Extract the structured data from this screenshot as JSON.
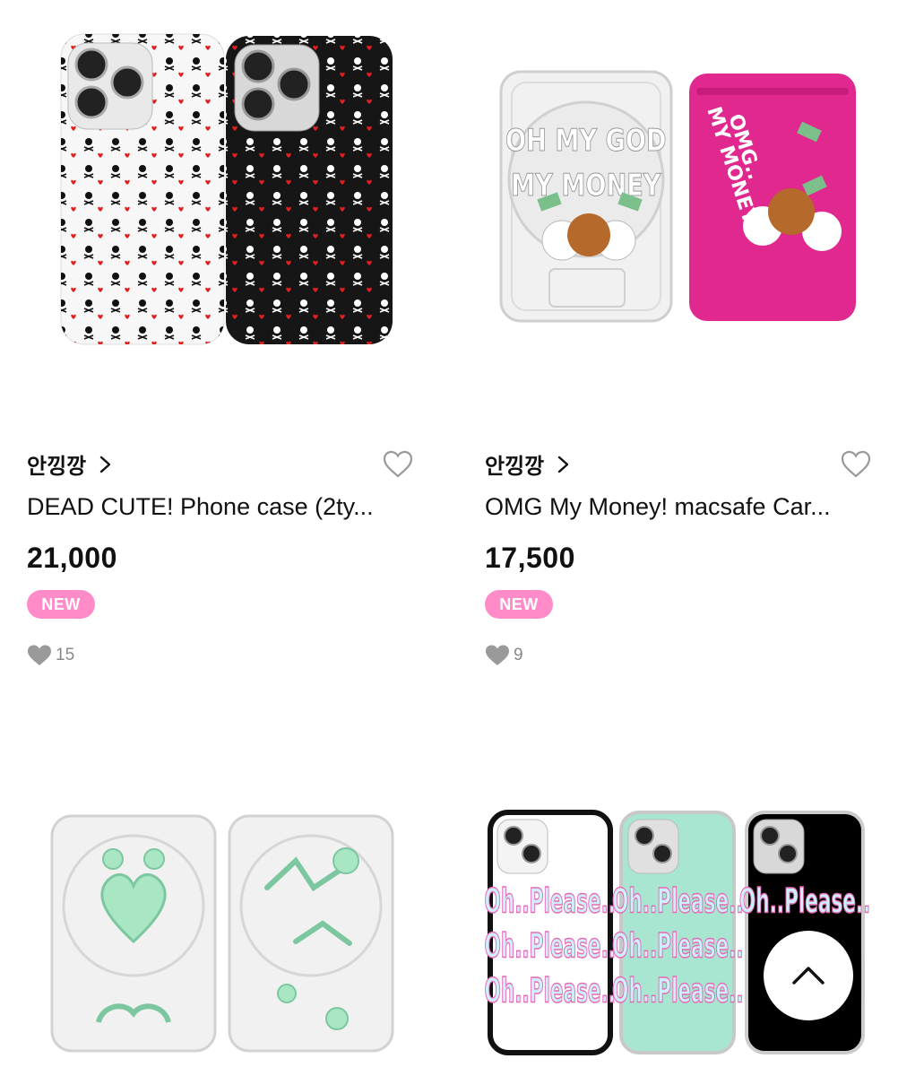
{
  "products": [
    {
      "shop": "안낑깡",
      "title": "DEAD CUTE! Phone case (2ty...",
      "price": "21,000",
      "badge": "NEW",
      "likes": "15",
      "image": "skull-pattern-phone-cases"
    },
    {
      "shop": "안낑깡",
      "title": "OMG My Money! macsafe Car...",
      "price": "17,500",
      "badge": "NEW",
      "likes": "9",
      "image": "omg-my-money-card-holders",
      "image_text": {
        "left_card": [
          "OH MY GOD",
          "MY MONEY"
        ],
        "right_card": [
          "OMG..",
          "MY MONEY"
        ]
      }
    },
    {
      "image": "green-doodle-clear-card-holders"
    },
    {
      "image": "oh-please-phone-cases",
      "image_text": [
        "Oh..Please..",
        "Oh..Please..",
        "Oh..Please.."
      ]
    }
  ],
  "colors": {
    "badge": "#ff8cc8",
    "like_icon": "#9a9a9a",
    "text": "#111111",
    "magenta_case": "#e0288f",
    "mint_case": "#a8e6d2"
  },
  "icons": {
    "wishlist": "heart-outline-icon",
    "likes": "heart-filled-icon",
    "shop_link": "chevron-right-icon",
    "scroll_top": "chevron-up-icon"
  }
}
